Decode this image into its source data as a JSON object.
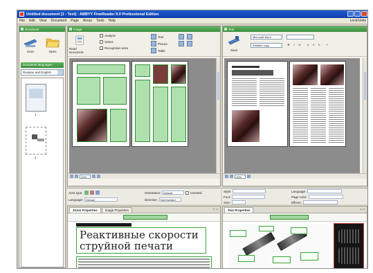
{
  "window": {
    "title": "Untitled document [1 - Text] - ABBYY FineReader 9.0 Professional Edition"
  },
  "menu": {
    "items": [
      "File",
      "Edit",
      "View",
      "Document",
      "Page",
      "Areas",
      "Tools",
      "Help"
    ],
    "right_label": "Lock/Units"
  },
  "left_panel": {
    "header": "Document",
    "scan_label": "Scan",
    "open_label": "Open",
    "languages_header": "Document languages",
    "language_value": "Russian and English",
    "pages": [
      {
        "number": "1"
      },
      {
        "number": "2"
      }
    ]
  },
  "image_pane": {
    "header": "Image",
    "read_label": "Read Document",
    "options": [
      "Analyze",
      "Select",
      "Recognition area"
    ],
    "tools": [
      "Text",
      "Picture",
      "Table"
    ],
    "zoom": "10%"
  },
  "text_pane": {
    "header": "Text",
    "save_label": "Save",
    "font": "Microsoft Word",
    "mode": "Editable copy"
  },
  "area_props": {
    "rows": [
      {
        "label": "Area type:"
      },
      {
        "label": "Language:",
        "value": "Default"
      }
    ],
    "orientation_label": "Orientation:",
    "orientation_value": "Default",
    "inverted_label": "Inverted",
    "direction_label": "Direction:",
    "direction_value": "Not inverted"
  },
  "text_props": {
    "labels": [
      "Style:",
      "Font:",
      "Size:"
    ],
    "right_labels": [
      "Language:",
      "Page color:",
      "Effects:"
    ]
  },
  "bottom_left": {
    "tabs": [
      "Zoom Properties",
      "Image Properties"
    ],
    "heading": "Реактивные скорости струйной печати"
  },
  "bottom_right": {
    "tabs": [
      "Text Properties"
    ]
  },
  "colors": {
    "title_bar": "#1e5bd0",
    "pane_header": "#4a9f4a",
    "area_green": "#3aa33a"
  }
}
